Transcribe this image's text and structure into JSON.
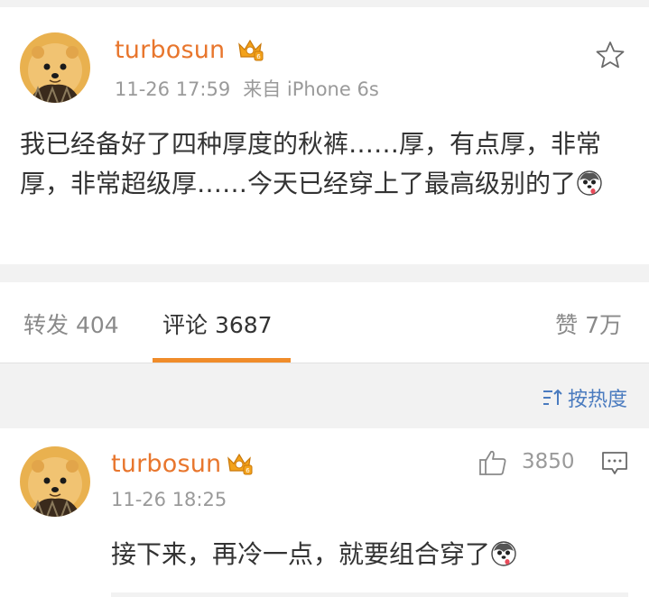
{
  "post": {
    "avatar": "dog-avatar",
    "username": "turbosun",
    "badge_icon": "vip-crown-icon",
    "time": "11-26 17:59",
    "source": "来自 iPhone 6s",
    "text": "我已经备好了四种厚度的秋裤……厚，有点厚，非常厚，非常超级厚……今天已经穿上了最高级别的了",
    "emoji": "husky-emoji",
    "favorite_icon": "star-icon"
  },
  "tabs": {
    "repost": "转发 404",
    "comments": "评论 3687",
    "likes": "赞 7万",
    "active": "comments"
  },
  "sort": {
    "label": "按热度",
    "icon": "sort-icon"
  },
  "comment": {
    "avatar": "dog-avatar",
    "username": "turbosun",
    "badge_icon": "vip-crown-icon",
    "time": "11-26 18:25",
    "likes": "3850",
    "text": "接下来，再冷一点，就要组合穿了",
    "emoji": "husky-emoji"
  },
  "colors": {
    "username": "#e8762d",
    "active_tab_underline": "#f08c2a",
    "link": "#4a7bbf",
    "meta": "#9a9a9a",
    "text": "#333333",
    "background": "#f2f2f2"
  }
}
